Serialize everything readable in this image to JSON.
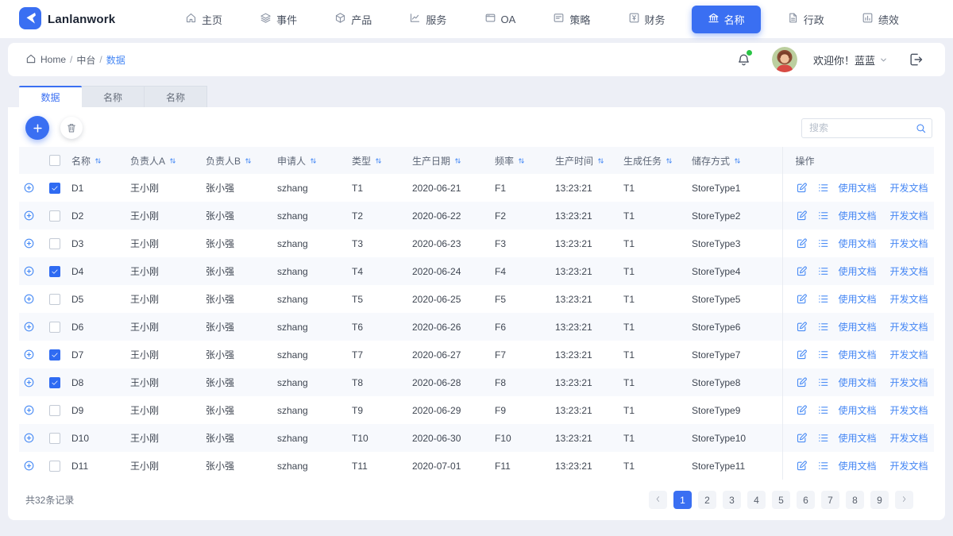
{
  "colors": {
    "primary": "#3a6ff2",
    "link": "#4486f4",
    "stripe": "#f7f9fd",
    "header_bg": "#f6f8fc",
    "green_dot": "#28c445"
  },
  "nav": {
    "brand": "Lanlanwork",
    "items": [
      {
        "label": "主页",
        "icon": "home-icon",
        "active": false
      },
      {
        "label": "事件",
        "icon": "layers-icon",
        "active": false
      },
      {
        "label": "产品",
        "icon": "box-icon",
        "active": false
      },
      {
        "label": "服务",
        "icon": "chart-icon",
        "active": false
      },
      {
        "label": "OA",
        "icon": "window-icon",
        "active": false
      },
      {
        "label": "策略",
        "icon": "card-icon",
        "active": false
      },
      {
        "label": "财务",
        "icon": "finance-icon",
        "active": false
      },
      {
        "label": "名称",
        "icon": "bank-icon",
        "active": true
      },
      {
        "label": "行政",
        "icon": "doc-icon",
        "active": false
      },
      {
        "label": "绩效",
        "icon": "performance-icon",
        "active": false
      }
    ]
  },
  "breadcrumb": {
    "items": [
      "Home",
      "中台",
      "数据"
    ]
  },
  "user": {
    "welcome": "欢迎你！蓝蓝"
  },
  "tabs": [
    {
      "label": "数据",
      "active": true
    },
    {
      "label": "名称",
      "active": false
    },
    {
      "label": "名称",
      "active": false
    }
  ],
  "toolbar": {
    "search_placeholder": "搜索"
  },
  "table": {
    "columns": [
      "名称",
      "负责人A",
      "负责人B",
      "申请人",
      "类型",
      "生产日期",
      "频率",
      "生产时间",
      "生成任务",
      "储存方式"
    ],
    "action_column": "操作",
    "action_links": [
      "使用文档",
      "开发文档"
    ],
    "rows": [
      {
        "name": "D1",
        "owner_a": "王小刚",
        "owner_b": "张小强",
        "applicant": "szhang",
        "type": "T1",
        "date": "2020-06-21",
        "freq": "F1",
        "time": "13:23:21",
        "task": "T1",
        "store": "StoreType1",
        "checked": true
      },
      {
        "name": "D2",
        "owner_a": "王小刚",
        "owner_b": "张小强",
        "applicant": "szhang",
        "type": "T2",
        "date": "2020-06-22",
        "freq": "F2",
        "time": "13:23:21",
        "task": "T1",
        "store": "StoreType2",
        "checked": false
      },
      {
        "name": "D3",
        "owner_a": "王小刚",
        "owner_b": "张小强",
        "applicant": "szhang",
        "type": "T3",
        "date": "2020-06-23",
        "freq": "F3",
        "time": "13:23:21",
        "task": "T1",
        "store": "StoreType3",
        "checked": false
      },
      {
        "name": "D4",
        "owner_a": "王小刚",
        "owner_b": "张小强",
        "applicant": "szhang",
        "type": "T4",
        "date": "2020-06-24",
        "freq": "F4",
        "time": "13:23:21",
        "task": "T1",
        "store": "StoreType4",
        "checked": true
      },
      {
        "name": "D5",
        "owner_a": "王小刚",
        "owner_b": "张小强",
        "applicant": "szhang",
        "type": "T5",
        "date": "2020-06-25",
        "freq": "F5",
        "time": "13:23:21",
        "task": "T1",
        "store": "StoreType5",
        "checked": false
      },
      {
        "name": "D6",
        "owner_a": "王小刚",
        "owner_b": "张小强",
        "applicant": "szhang",
        "type": "T6",
        "date": "2020-06-26",
        "freq": "F6",
        "time": "13:23:21",
        "task": "T1",
        "store": "StoreType6",
        "checked": false
      },
      {
        "name": "D7",
        "owner_a": "王小刚",
        "owner_b": "张小强",
        "applicant": "szhang",
        "type": "T7",
        "date": "2020-06-27",
        "freq": "F7",
        "time": "13:23:21",
        "task": "T1",
        "store": "StoreType7",
        "checked": true
      },
      {
        "name": "D8",
        "owner_a": "王小刚",
        "owner_b": "张小强",
        "applicant": "szhang",
        "type": "T8",
        "date": "2020-06-28",
        "freq": "F8",
        "time": "13:23:21",
        "task": "T1",
        "store": "StoreType8",
        "checked": true
      },
      {
        "name": "D9",
        "owner_a": "王小刚",
        "owner_b": "张小强",
        "applicant": "szhang",
        "type": "T9",
        "date": "2020-06-29",
        "freq": "F9",
        "time": "13:23:21",
        "task": "T1",
        "store": "StoreType9",
        "checked": false
      },
      {
        "name": "D10",
        "owner_a": "王小刚",
        "owner_b": "张小强",
        "applicant": "szhang",
        "type": "T10",
        "date": "2020-06-30",
        "freq": "F10",
        "time": "13:23:21",
        "task": "T1",
        "store": "StoreType10",
        "checked": false
      },
      {
        "name": "D11",
        "owner_a": "王小刚",
        "owner_b": "张小强",
        "applicant": "szhang",
        "type": "T11",
        "date": "2020-07-01",
        "freq": "F11",
        "time": "13:23:21",
        "task": "T1",
        "store": "StoreType11",
        "checked": false
      }
    ]
  },
  "footer": {
    "total": "共32条记录",
    "pagination": {
      "pages": [
        "1",
        "2",
        "3",
        "4",
        "5",
        "6",
        "7",
        "8",
        "9"
      ],
      "active": "1",
      "prev": "‹",
      "next": "›"
    }
  }
}
